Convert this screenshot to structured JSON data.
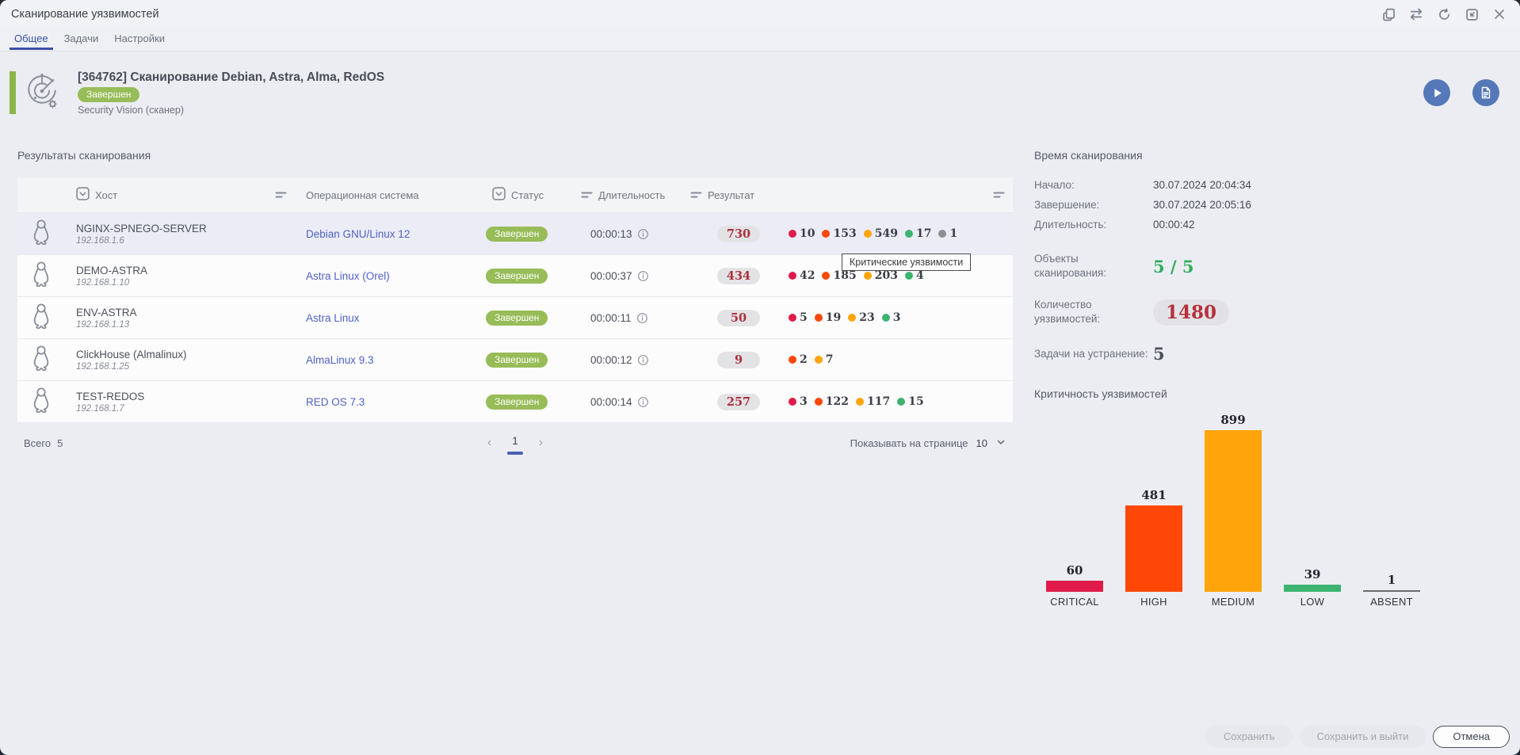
{
  "titlebar": {
    "title": "Сканирование уязвимостей"
  },
  "tabs": {
    "general": "Общее",
    "tasks": "Задачи",
    "settings": "Настройки"
  },
  "scan_header": {
    "title": "[364762] Сканирование Debian, Astra, Alma, RedOS",
    "status_badge": "Завершен",
    "subtitle": "Security Vision (сканер)"
  },
  "results": {
    "section_title": "Результаты сканирования",
    "columns": {
      "host": "Хост",
      "os": "Операционная система",
      "status": "Статус",
      "duration": "Длительность",
      "result": "Результат"
    },
    "tooltip": "Критические уязвимости",
    "rows": [
      {
        "host": "NGINX-SPNEGO-SERVER",
        "ip": "192.168.1.6",
        "os": "Debian GNU/Linux 12",
        "status": "Завершен",
        "duration": "00:00:13",
        "total": "730",
        "highlighted": true,
        "severities": [
          {
            "level": "critical",
            "count": "10"
          },
          {
            "level": "high",
            "count": "153"
          },
          {
            "level": "medium",
            "count": "549"
          },
          {
            "level": "low",
            "count": "17"
          },
          {
            "level": "absent",
            "count": "1"
          }
        ]
      },
      {
        "host": "DEMO-ASTRA",
        "ip": "192.168.1.10",
        "os": "Astra Linux (Orel)",
        "status": "Завершен",
        "duration": "00:00:37",
        "total": "434",
        "highlighted": false,
        "severities": [
          {
            "level": "critical",
            "count": "42"
          },
          {
            "level": "high",
            "count": "185"
          },
          {
            "level": "medium",
            "count": "203"
          },
          {
            "level": "low",
            "count": "4"
          }
        ]
      },
      {
        "host": "ENV-ASTRA",
        "ip": "192.168.1.13",
        "os": "Astra Linux",
        "status": "Завершен",
        "duration": "00:00:11",
        "total": "50",
        "highlighted": false,
        "severities": [
          {
            "level": "critical",
            "count": "5"
          },
          {
            "level": "high",
            "count": "19"
          },
          {
            "level": "medium",
            "count": "23"
          },
          {
            "level": "low",
            "count": "3"
          }
        ]
      },
      {
        "host": "ClickHouse (Almalinux)",
        "ip": "192.168.1.25",
        "os": "AlmaLinux 9.3",
        "status": "Завершен",
        "duration": "00:00:12",
        "total": "9",
        "highlighted": false,
        "severities": [
          {
            "level": "high",
            "count": "2"
          },
          {
            "level": "medium",
            "count": "7"
          }
        ]
      },
      {
        "host": "TEST-REDOS",
        "ip": "192.168.1.7",
        "os": "RED OS 7.3",
        "status": "Завершен",
        "duration": "00:00:14",
        "total": "257",
        "highlighted": false,
        "severities": [
          {
            "level": "critical",
            "count": "3"
          },
          {
            "level": "high",
            "count": "122"
          },
          {
            "level": "medium",
            "count": "117"
          },
          {
            "level": "low",
            "count": "15"
          }
        ]
      }
    ],
    "footer": {
      "total_label": "Всего",
      "total_value": "5",
      "page": "1",
      "per_page_label": "Показывать на странице",
      "per_page_value": "10"
    }
  },
  "severity_colors": {
    "critical": "#e01b4b",
    "high": "#ff4708",
    "medium": "#ffa40a",
    "low": "#3cb371",
    "absent": "#8d8d8d"
  },
  "summary": {
    "time_title": "Время сканирования",
    "start_label": "Начало:",
    "start_value": "30.07.2024 20:04:34",
    "end_label": "Завершение:",
    "end_value": "30.07.2024 20:05:16",
    "duration_label": "Длительность:",
    "duration_value": "00:00:42",
    "objects_label": "Объекты сканирования:",
    "objects_value": "5 / 5",
    "vulns_label": "Количество уязвимостей:",
    "vulns_value": "1480",
    "tasks_label": "Задачи на устранение:",
    "tasks_value": "5"
  },
  "chart_data": {
    "type": "bar",
    "title": "Критичность уязвимостей",
    "categories": [
      "CRITICAL",
      "HIGH",
      "MEDIUM",
      "LOW",
      "ABSENT"
    ],
    "values": [
      60,
      481,
      899,
      39,
      1
    ],
    "colors": [
      "#e01b4b",
      "#ff4708",
      "#ffa40a",
      "#3cb371",
      "#6e6e6e"
    ],
    "value_labels": true,
    "ylim": [
      0,
      899
    ],
    "grid": false,
    "legend": "none",
    "xlabel": "",
    "ylabel": ""
  },
  "action_buttons": {
    "save": "Сохранить",
    "save_exit": "Сохранить и выйти",
    "cancel": "Отмена"
  }
}
